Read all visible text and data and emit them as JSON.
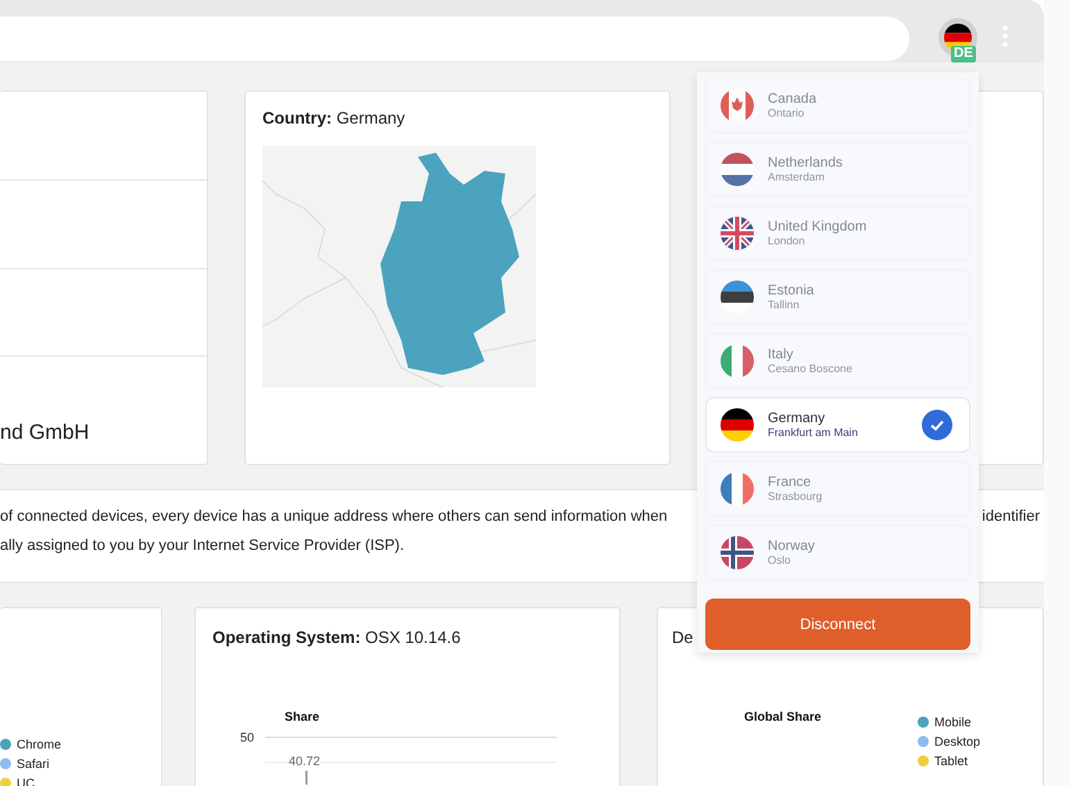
{
  "toolbar": {
    "badge": "DE"
  },
  "info_card": {
    "text": "nd GmbH"
  },
  "map_card": {
    "label": "Country:",
    "value": "Germany"
  },
  "description": {
    "line_1": "of connected devices, every device has a unique address where others can send information when",
    "line_1_end": "identifier",
    "line_2": "ally assigned to you by your Internet Service Provider (ISP)."
  },
  "browser_card": {
    "legend": [
      {
        "name": "Chrome",
        "color": "#4ba3bd"
      },
      {
        "name": "Safari",
        "color": "#8cbdf0"
      },
      {
        "name": "UC",
        "color": "#f2cf3a"
      }
    ]
  },
  "os_card": {
    "label": "Operating System:",
    "value": "OSX 10.14.6",
    "chart": {
      "title": "Share",
      "axis_label": "50",
      "data_label": "40.72"
    }
  },
  "device_card": {
    "label": "De",
    "chart_title": "Global Share",
    "legend": [
      {
        "name": "Mobile",
        "color": "#4ba3bd"
      },
      {
        "name": "Desktop",
        "color": "#8cbdf0"
      },
      {
        "name": "Tablet",
        "color": "#f2cf3a"
      }
    ]
  },
  "locations": [
    {
      "country": "Canada",
      "city": "Ontario",
      "kind": "ca",
      "selected": false
    },
    {
      "country": "Netherlands",
      "city": "Amsterdam",
      "kind": "nl",
      "selected": false
    },
    {
      "country": "United Kingdom",
      "city": "London",
      "kind": "gb",
      "selected": false
    },
    {
      "country": "Estonia",
      "city": "Tallinn",
      "kind": "ee",
      "selected": false
    },
    {
      "country": "Italy",
      "city": "Cesano Boscone",
      "kind": "it",
      "selected": false
    },
    {
      "country": "Germany",
      "city": "Frankfurt am Main",
      "kind": "de",
      "selected": true
    },
    {
      "country": "France",
      "city": "Strasbourg",
      "kind": "fr",
      "selected": false
    },
    {
      "country": "Norway",
      "city": "Oslo",
      "kind": "no",
      "selected": false
    }
  ],
  "disconnect_button": "Disconnect"
}
